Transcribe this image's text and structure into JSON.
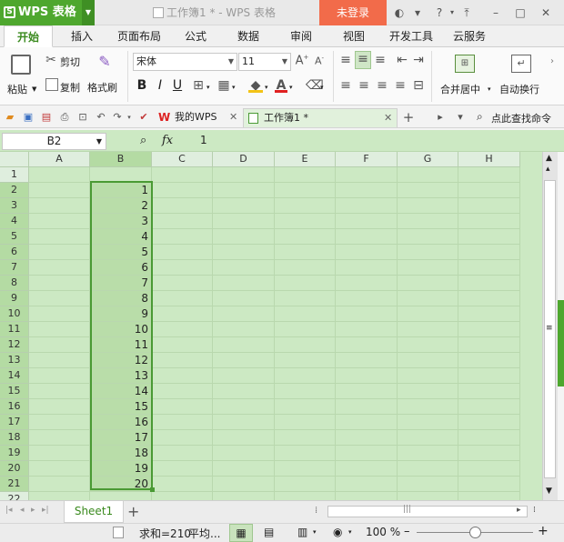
{
  "titlebar": {
    "app_name": "WPS 表格",
    "logo_glyph": "S",
    "document_title": "工作簿1 * - WPS 表格",
    "login_label": "未登录"
  },
  "menu": {
    "tabs": [
      "开始",
      "插入",
      "页面布局",
      "公式",
      "数据",
      "审阅",
      "视图",
      "开发工具",
      "云服务"
    ]
  },
  "ribbon": {
    "cut": "剪切",
    "paste": "粘贴",
    "copy": "复制",
    "format_painter": "格式刷",
    "font_name": "宋体",
    "font_size": "11",
    "merge_center": "合并居中",
    "wrap_text": "自动换行"
  },
  "quickbar": {
    "my_wps_tab": "我的WPS",
    "document_tab": "工作簿1 *",
    "search_command": "点此查找命令"
  },
  "formula_bar": {
    "name_box": "B2",
    "fx_label": "fx",
    "content": "1"
  },
  "grid": {
    "columns": [
      "A",
      "B",
      "C",
      "D",
      "E",
      "F",
      "G",
      "H"
    ],
    "rows": [
      "1",
      "2",
      "3",
      "4",
      "5",
      "6",
      "7",
      "8",
      "9",
      "10",
      "11",
      "12",
      "13",
      "14",
      "15",
      "16",
      "17",
      "18",
      "19",
      "20",
      "21",
      "22"
    ],
    "column_b_values": [
      "",
      "1",
      "2",
      "3",
      "4",
      "5",
      "6",
      "7",
      "8",
      "9",
      "10",
      "11",
      "12",
      "13",
      "14",
      "15",
      "16",
      "17",
      "18",
      "19",
      "20",
      ""
    ]
  },
  "sheets": {
    "tabs": [
      "Sheet1"
    ],
    "add_label": "+"
  },
  "statusbar": {
    "sum_text": "求和=210",
    "avg_text": "平均...",
    "zoom": "100 %"
  },
  "colors": {
    "brand_green": "#4ea72e",
    "grid_bg": "#cce9c3",
    "login_orange": "#f26b4a",
    "selection_border": "#4a9a34"
  }
}
